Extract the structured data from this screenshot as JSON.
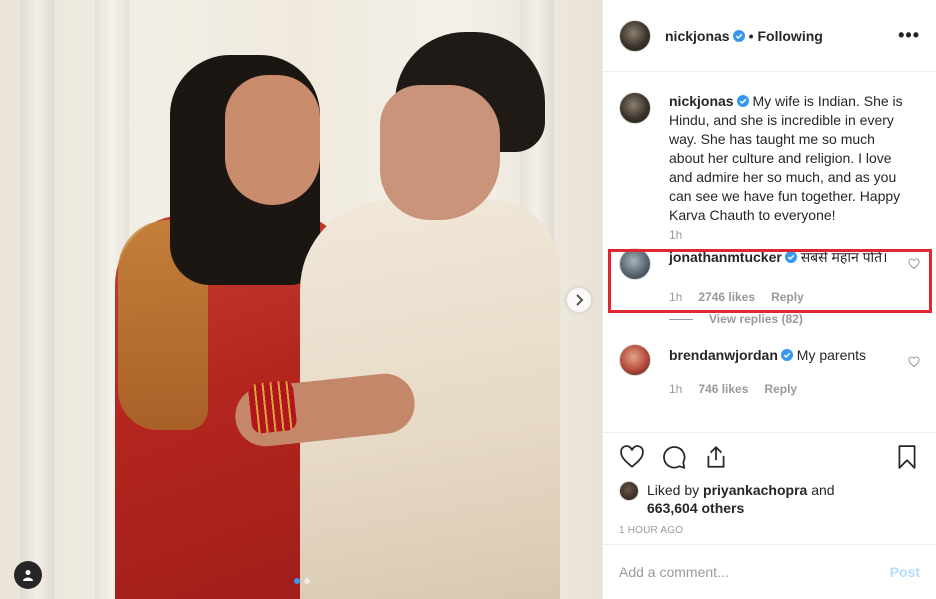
{
  "photo": {
    "description_alt": "",
    "carousel_dots": 2,
    "active_dot": 0
  },
  "header": {
    "username": "nickjonas",
    "separator": "•",
    "follow_label": "Following",
    "more_label": "•••"
  },
  "caption": {
    "username": "nickjonas",
    "text": "My wife is Indian. She is Hindu, and she is incredible in every way. She has taught me so much about her culture and religion. I love and admire her so much, and as you can see we have fun together. Happy Karva Chauth to everyone!",
    "time": "1h"
  },
  "comments": [
    {
      "username": "jonathanmtucker",
      "text": "सबसे महान पति।",
      "time": "1h",
      "likes": "2746 likes",
      "reply_label": "Reply",
      "view_replies": "View replies (82)"
    },
    {
      "username": "brendanwjordan",
      "text": "My parents",
      "time": "1h",
      "likes": "746 likes",
      "reply_label": "Reply"
    }
  ],
  "likes": {
    "prefix": "Liked by",
    "user": "priyankachopra",
    "and": "and",
    "count": "663,604 others"
  },
  "timeago": "1 HOUR AGO",
  "add_comment": {
    "placeholder": "Add a comment...",
    "post_label": "Post"
  },
  "colors": {
    "verified": "#3897f0",
    "highlight": "#e0262e",
    "post_disabled": "#b2dffc"
  }
}
